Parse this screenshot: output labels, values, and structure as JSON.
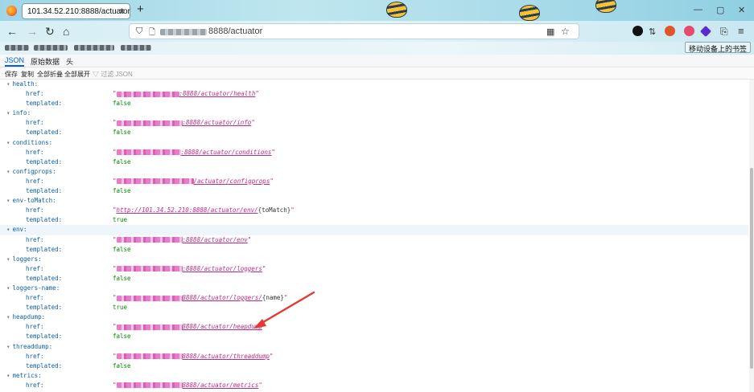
{
  "browser": {
    "tab_title": "101.34.52.210:8888/actuator",
    "new_tab": "+",
    "close": "×",
    "url_text": "8888/actuator",
    "mobile_bookmarks": "移动设备上的书签",
    "window_controls": [
      "—",
      "▢",
      "✕"
    ]
  },
  "viewer": {
    "tabs": [
      "JSON",
      "原始数据",
      "头"
    ],
    "active_tab": "JSON",
    "toolbar": [
      "保存",
      "复制",
      "全部折叠",
      "全部展开"
    ],
    "filter_placeholder": "过滤 JSON"
  },
  "json_rows": [
    {
      "type": "section",
      "key": "health:"
    },
    {
      "type": "href",
      "key": "href:",
      "suffix": ":8888/actuator/health",
      "redact_w": 78
    },
    {
      "type": "bool",
      "key": "templated:",
      "value": "false"
    },
    {
      "type": "section",
      "key": "info:"
    },
    {
      "type": "href",
      "key": "href:",
      "suffix": ":8888/actuator/info",
      "redact_w": 82
    },
    {
      "type": "bool",
      "key": "templated:",
      "value": "false"
    },
    {
      "type": "section",
      "key": "conditions:"
    },
    {
      "type": "href",
      "key": "href:",
      "suffix": ":8888/actuator/conditions",
      "redact_w": 80
    },
    {
      "type": "bool",
      "key": "templated:",
      "value": "false"
    },
    {
      "type": "section",
      "key": "configprops:"
    },
    {
      "type": "href",
      "key": "href:",
      "suffix": "/actuator/configprops",
      "redact_w": 96
    },
    {
      "type": "bool",
      "key": "templated:",
      "value": "false"
    },
    {
      "type": "section",
      "key": "env-toMatch:"
    },
    {
      "type": "fullhref",
      "key": "href:",
      "link": "http://101.34.52.210:8888/actuator/env/",
      "tail": "{toMatch}"
    },
    {
      "type": "bool",
      "key": "templated:",
      "value": "true"
    },
    {
      "type": "section",
      "key": "env:",
      "highlight": true
    },
    {
      "type": "href",
      "key": "href:",
      "suffix": ":8888/actuator/env",
      "redact_w": 82
    },
    {
      "type": "bool",
      "key": "templated:",
      "value": "false"
    },
    {
      "type": "section",
      "key": "loggers:"
    },
    {
      "type": "href",
      "key": "href:",
      "suffix": ":8888/actuator/loggers",
      "redact_w": 82
    },
    {
      "type": "bool",
      "key": "templated:",
      "value": "false"
    },
    {
      "type": "section",
      "key": "loggers-name:"
    },
    {
      "type": "hreftail",
      "key": "href:",
      "suffix": "8888/actuator/loggers/",
      "tail": "{name}",
      "redact_w": 82
    },
    {
      "type": "bool",
      "key": "templated:",
      "value": "true"
    },
    {
      "type": "section",
      "key": "heapdump:"
    },
    {
      "type": "href",
      "key": "href:",
      "suffix": "8888/actuator/heapdump",
      "redact_w": 82
    },
    {
      "type": "bool",
      "key": "templated:",
      "value": "false"
    },
    {
      "type": "section",
      "key": "threaddump:"
    },
    {
      "type": "href",
      "key": "href:",
      "suffix": "8888/actuator/threaddump",
      "redact_w": 82
    },
    {
      "type": "bool",
      "key": "templated:",
      "value": "false"
    },
    {
      "type": "section",
      "key": "metrics:"
    },
    {
      "type": "href",
      "key": "href:",
      "suffix": "8888/actuator/metrics",
      "redact_w": 82
    }
  ],
  "colors": {
    "key": "#0d5fa6",
    "bool": "#058b00",
    "link": "#c22a82",
    "annotation_arrow": "#e53935"
  },
  "icons": [
    "firefox-logo-icon",
    "back-arrow-icon",
    "forward-arrow-icon",
    "reload-icon",
    "home-icon",
    "shield-icon",
    "lock-icon",
    "qr-code-icon",
    "star-icon",
    "menu-icon",
    "red-annotation-arrow-icon"
  ]
}
